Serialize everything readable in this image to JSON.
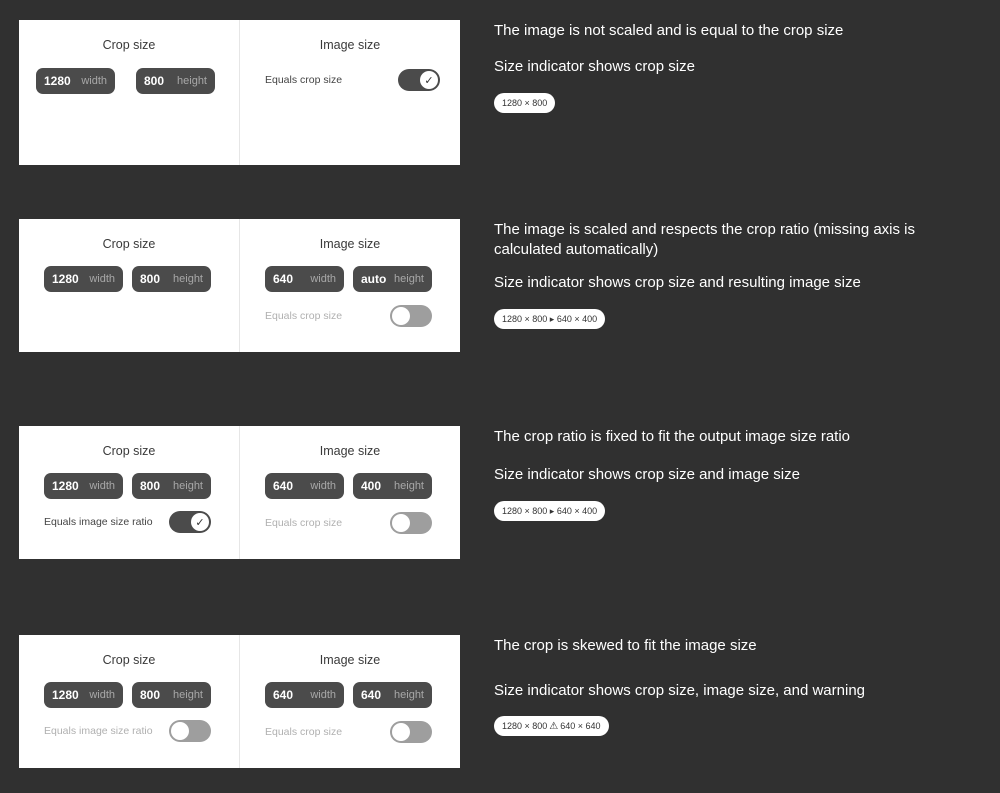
{
  "sections": [
    {
      "crop": {
        "title": "Crop size",
        "width_value": "1280",
        "width_unit": "width",
        "height_value": "800",
        "height_unit": "height"
      },
      "image": {
        "title": "Image size",
        "toggle_label": "Equals crop size"
      },
      "description1": "The image is not scaled and is equal to the crop size",
      "description2": "Size indicator shows crop size",
      "badge": "1280 × 800"
    },
    {
      "crop": {
        "title": "Crop size",
        "width_value": "1280",
        "width_unit": "width",
        "height_value": "800",
        "height_unit": "height"
      },
      "image": {
        "title": "Image size",
        "width_value": "640",
        "width_unit": "width",
        "height_value": "auto",
        "height_unit": "height",
        "toggle_label": "Equals crop size"
      },
      "description1": "The image is scaled and respects the crop ratio (missing axis is calculated automatically)",
      "description2": "Size indicator shows crop size and resulting image size",
      "badge": "1280 × 800 ▸ 640 × 400"
    },
    {
      "crop": {
        "title": "Crop size",
        "width_value": "1280",
        "width_unit": "width",
        "height_value": "800",
        "height_unit": "height",
        "toggle_label": "Equals image size ratio"
      },
      "image": {
        "title": "Image size",
        "width_value": "640",
        "width_unit": "width",
        "height_value": "400",
        "height_unit": "height",
        "toggle_label": "Equals crop size"
      },
      "description1": "The crop ratio is fixed to fit the output image size ratio",
      "description2": "Size indicator shows crop size and image size",
      "badge": "1280 × 800 ▸ 640 × 400"
    },
    {
      "crop": {
        "title": "Crop size",
        "width_value": "1280",
        "width_unit": "width",
        "height_value": "800",
        "height_unit": "height",
        "toggle_label": "Equals image size ratio"
      },
      "image": {
        "title": "Image size",
        "width_value": "640",
        "width_unit": "width",
        "height_value": "640",
        "height_unit": "height",
        "toggle_label": "Equals crop size"
      },
      "description1": "The crop is skewed to fit the image size",
      "description2": "Size indicator shows crop size, image size, and warning",
      "badge_left": "1280 × 800",
      "badge_right": "640 × 640",
      "badge_icon": "warning-icon"
    }
  ],
  "toggle_states": {
    "s1_image": true,
    "s2_image": false,
    "s3_crop": true,
    "s3_image": false,
    "s4_crop": false,
    "s4_image": false
  },
  "colors": {
    "background": "#303030",
    "card": "#ffffff",
    "pill": "#4b4b4b",
    "toggle_on": "#4b4b4b",
    "toggle_off": "#9e9e9e"
  }
}
